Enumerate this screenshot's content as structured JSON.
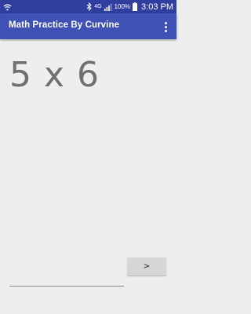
{
  "status_bar": {
    "network": "4G",
    "signal_bars": 3,
    "battery_percent": "100%",
    "time": "3:03 PM",
    "icons": [
      "wifi-icon",
      "bluetooth-icon",
      "lte-icon",
      "signal-icon",
      "battery-icon"
    ]
  },
  "app_bar": {
    "title": "Math Practice By Curvine",
    "overflow_icon": "more-vert-icon"
  },
  "problem": {
    "text": "5 x 6"
  },
  "answer": {
    "value": "",
    "placeholder": ""
  },
  "next_button": {
    "label": ">"
  },
  "colors": {
    "status_bar": "#303f9f",
    "app_bar": "#3f51b5",
    "background": "#eeeeee",
    "problem_text": "#707070",
    "button": "#d6d6d6"
  }
}
